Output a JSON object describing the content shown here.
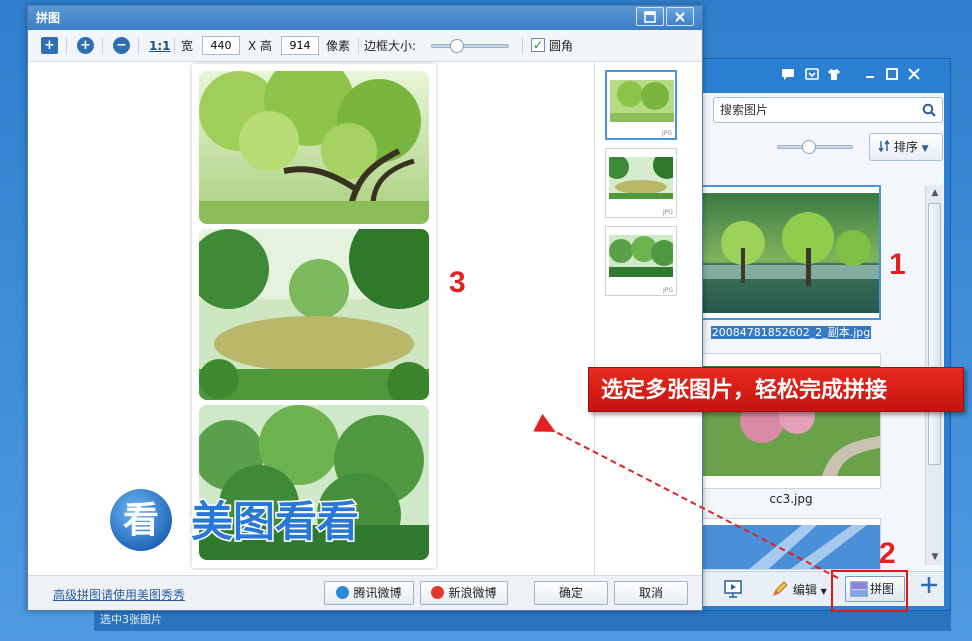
{
  "dialog": {
    "title": "拼图",
    "toolbar": {
      "ratio_label": "1:1",
      "width_label": "宽",
      "width_value": "440",
      "x_label": "X",
      "height_label": "高",
      "height_value": "914",
      "unit_label": "像素",
      "border_label": "边框大小:",
      "border_value": 0.3,
      "round_label": "圆角",
      "round_checked": true
    },
    "footer": {
      "advanced_link": "高级拼图请使用美图秀秀",
      "tencent_label": "腾讯微博",
      "sina_label": "新浪微博",
      "ok_label": "确定",
      "cancel_label": "取消"
    },
    "thumb_ext": "JPG"
  },
  "browser": {
    "search_placeholder": "搜索图片",
    "sort_label": "排序",
    "zoom_value": 0.4,
    "files": [
      {
        "name": "20084781852602_2_副本.jpg",
        "selected": true
      },
      {
        "name": "cc3.jpg",
        "selected": false
      }
    ],
    "edit_label": "编辑",
    "merge_label": "拼图",
    "status_text": "选中3张图片"
  },
  "annotations": {
    "mark_1": "1",
    "mark_2": "2",
    "mark_3": "3",
    "banner_text": "选定多张图片，轻松完成拼接",
    "logo_text": "美图看看",
    "logo_glyph": "看"
  },
  "colors": {
    "accent": "#3d7dc3",
    "annotation_red": "#e42020"
  }
}
